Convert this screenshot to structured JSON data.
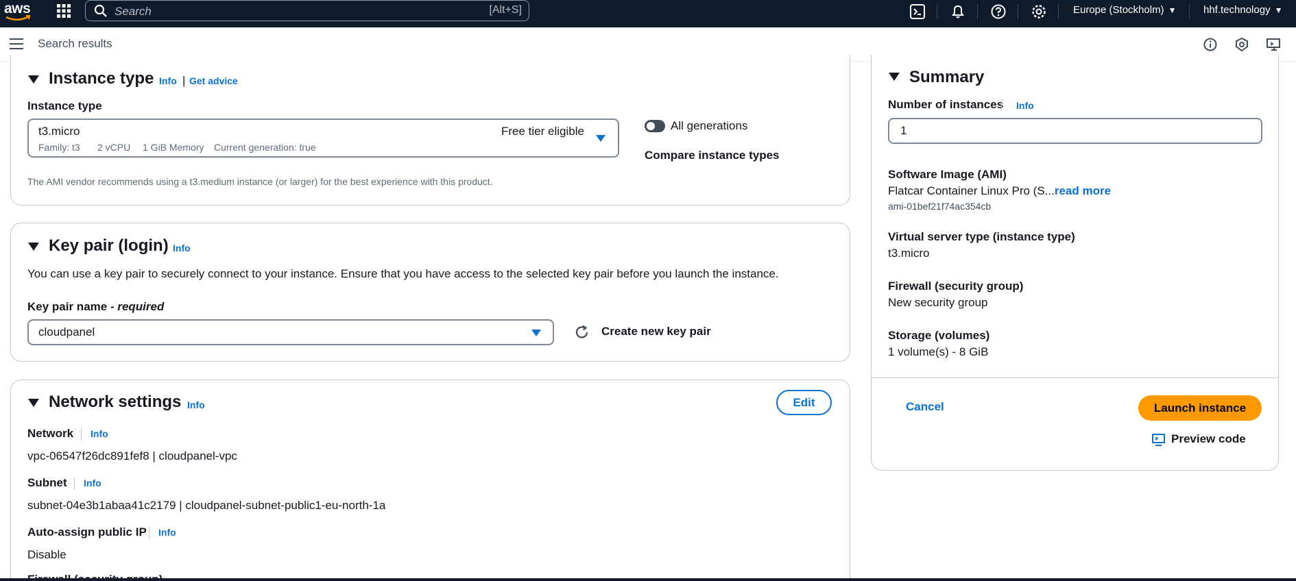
{
  "topnav": {
    "logo_text": "aws",
    "search_placeholder": "Search",
    "search_shortcut": "[Alt+S]",
    "region": "Europe (Stockholm)",
    "account": "hhf.technology",
    "icons": [
      "cloudshell-icon",
      "bell-icon",
      "help-icon",
      "settings-icon"
    ]
  },
  "subheader": {
    "title": "Search results",
    "icons": [
      "info-circle-icon",
      "security-shield-icon",
      "feedback-screen-icon"
    ]
  },
  "instance_type_panel": {
    "title": "Instance type",
    "info": "Info",
    "separator": "|",
    "get_advice": "Get advice",
    "field_label": "Instance type",
    "selected_type": "t3.micro",
    "free_tier": "Free tier eligible",
    "details": {
      "family": "Family: t3",
      "vcpu": "2 vCPU",
      "memory": "1 GiB Memory",
      "current_gen": "Current generation: true"
    },
    "toggle_label": "All generations",
    "toggle_on": false,
    "compare_link": "Compare instance types",
    "recommendation": "The AMI vendor recommends using a t3.medium instance (or larger) for the best experience with this product."
  },
  "key_pair_panel": {
    "title": "Key pair (login)",
    "info": "Info",
    "description": "You can use a key pair to securely connect to your instance. Ensure that you have access to the selected key pair before you launch the instance.",
    "field_label": "Key pair name - ",
    "field_required": "required",
    "selected": "cloudpanel",
    "create_link": "Create new key pair"
  },
  "network_panel": {
    "title": "Network settings",
    "info": "Info",
    "edit_label": "Edit",
    "network_label": "Network",
    "network_info": "Info",
    "network_value": "vpc-06547f26dc891fef8 | cloudpanel-vpc",
    "subnet_label": "Subnet",
    "subnet_info": "Info",
    "subnet_value": "subnet-04e3b1abaa41c2179 | cloudpanel-subnet-public1-eu-north-1a",
    "public_ip_label": "Auto-assign public IP",
    "public_ip_info": "Info",
    "public_ip_value": "Disable",
    "firewall_label_partial": "Firewall (security group)"
  },
  "summary_panel": {
    "title": "Summary",
    "instances_label": "Number of instances",
    "instances_info": "Info",
    "instances_value": "1",
    "ami_label": "Software Image (AMI)",
    "ami_value": "Flatcar Container Linux Pro (S...",
    "ami_read_more": "read more",
    "ami_id": "ami-01bef21f74ac354cb",
    "server_type_label": "Virtual server type (instance type)",
    "server_type_value": "t3.micro",
    "firewall_label": "Firewall (security group)",
    "firewall_value": "New security group",
    "storage_label": "Storage (volumes)",
    "storage_value": "1 volume(s) - 8 GiB",
    "cancel_label": "Cancel",
    "launch_label": "Launch instance",
    "preview_label": "Preview code"
  },
  "colors": {
    "nav_bg": "#0f1b2a",
    "link": "#0972d3",
    "launch_button": "#ff9900",
    "border": "#c6c6cd"
  }
}
